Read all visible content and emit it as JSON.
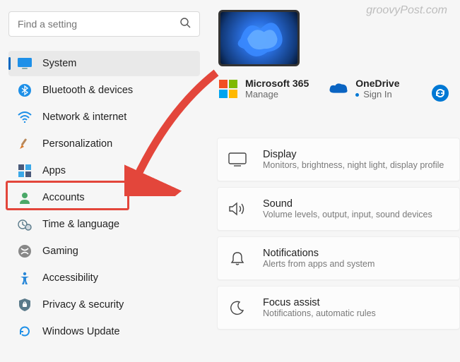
{
  "watermark": "groovyPost.com",
  "search": {
    "placeholder": "Find a setting"
  },
  "sidebar": {
    "items": [
      {
        "label": "System"
      },
      {
        "label": "Bluetooth & devices"
      },
      {
        "label": "Network & internet"
      },
      {
        "label": "Personalization"
      },
      {
        "label": "Apps"
      },
      {
        "label": "Accounts"
      },
      {
        "label": "Time & language"
      },
      {
        "label": "Gaming"
      },
      {
        "label": "Accessibility"
      },
      {
        "label": "Privacy & security"
      },
      {
        "label": "Windows Update"
      }
    ]
  },
  "tiles": {
    "ms365": {
      "title": "Microsoft 365",
      "sub": "Manage"
    },
    "onedrive": {
      "title": "OneDrive",
      "sub": "Sign In"
    }
  },
  "cards": [
    {
      "title": "Display",
      "sub": "Monitors, brightness, night light, display profile"
    },
    {
      "title": "Sound",
      "sub": "Volume levels, output, input, sound devices"
    },
    {
      "title": "Notifications",
      "sub": "Alerts from apps and system"
    },
    {
      "title": "Focus assist",
      "sub": "Notifications, automatic rules"
    }
  ]
}
